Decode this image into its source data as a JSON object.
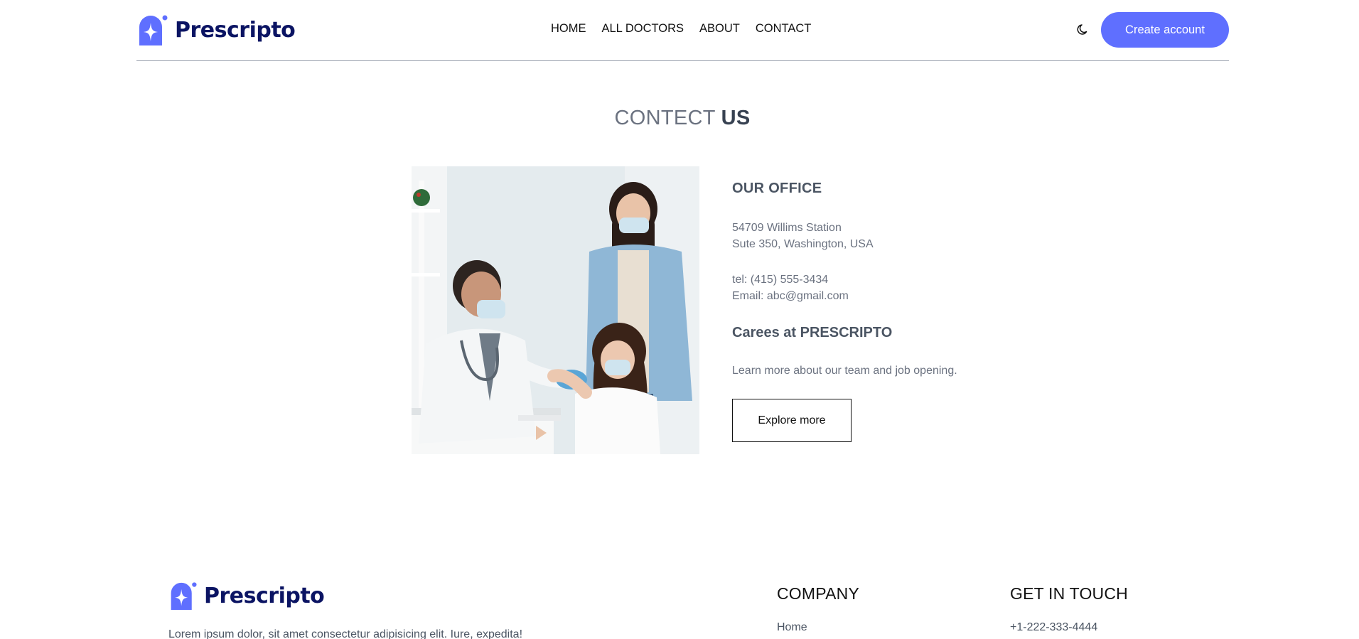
{
  "brand": {
    "name": "Prescripto",
    "color": "#5f6fff",
    "text_color": "#0b1463"
  },
  "nav": {
    "items": [
      {
        "label": "HOME"
      },
      {
        "label": "ALL DOCTORS"
      },
      {
        "label": "ABOUT"
      },
      {
        "label": "CONTACT"
      }
    ]
  },
  "header": {
    "theme_icon": "moon-icon",
    "create_account_label": "Create account"
  },
  "title": {
    "part1": "CONTECT ",
    "part2": "US"
  },
  "office": {
    "heading": "OUR OFFICE",
    "address_line1": "54709 Willims Station",
    "address_line2": "Sute 350, Washington, USA",
    "tel": "tel: (415) 555-3434",
    "email": "Email: abc@gmail.com"
  },
  "careers": {
    "heading": "Carees at PRESCRIPTO",
    "text": "Learn more about our team and job opening.",
    "button_label": "Explore more"
  },
  "footer": {
    "description": "Lorem ipsum dolor, sit amet consectetur adipisicing elit. Iure, expedita!",
    "company_heading": "COMPANY",
    "company_first_link": "Home",
    "touch_heading": "GET IN TOUCH",
    "phone": "+1-222-333-4444"
  }
}
